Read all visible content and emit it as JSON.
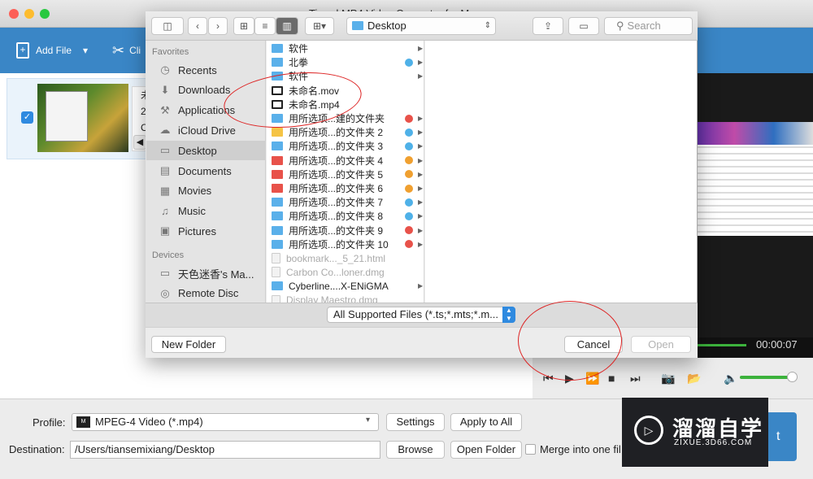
{
  "app": {
    "title": "Tipard MP4 Video Converter for Mac"
  },
  "toolbar": {
    "add_file": "Add File",
    "clip": "Cli"
  },
  "file_item": {
    "line1": "未",
    "line2": "2",
    "line3": "C"
  },
  "preview": {
    "time": "00:00:07"
  },
  "bottom": {
    "profile_label": "Profile:",
    "profile_value": "MPEG-4 Video (*.mp4)",
    "settings": "Settings",
    "apply_all": "Apply to All",
    "destination_label": "Destination:",
    "destination_value": "/Users/tiansemixiang/Desktop",
    "browse": "Browse",
    "open_folder": "Open Folder",
    "merge": "Merge into one fil",
    "convert": "t"
  },
  "watermark": {
    "cn": "溜溜自学",
    "en": "ZIXUE.3D66.COM"
  },
  "dialog": {
    "location": "Desktop",
    "search_placeholder": "Search",
    "favorites_label": "Favorites",
    "devices_label": "Devices",
    "favorites": [
      {
        "label": "Recents",
        "icon": "recents-icon"
      },
      {
        "label": "Downloads",
        "icon": "downloads-icon"
      },
      {
        "label": "Applications",
        "icon": "applications-icon"
      },
      {
        "label": "iCloud Drive",
        "icon": "cloud-icon"
      },
      {
        "label": "Desktop",
        "icon": "desktop-icon"
      },
      {
        "label": "Documents",
        "icon": "documents-icon"
      },
      {
        "label": "Movies",
        "icon": "movies-icon"
      },
      {
        "label": "Music",
        "icon": "music-icon"
      },
      {
        "label": "Pictures",
        "icon": "pictures-icon"
      }
    ],
    "devices": [
      {
        "label": "天色迷香's Ma...",
        "icon": "laptop-icon"
      },
      {
        "label": "Remote Disc",
        "icon": "disc-icon"
      }
    ],
    "files": [
      {
        "name": "软件",
        "kind": "folder",
        "tag": ""
      },
      {
        "name": "北拳",
        "kind": "folder",
        "tag": "#4fb1e8"
      },
      {
        "name": "软件",
        "kind": "folder",
        "tag": ""
      },
      {
        "name": "未命名.mov",
        "kind": "video",
        "tag": ""
      },
      {
        "name": "未命名.mp4",
        "kind": "video",
        "tag": ""
      },
      {
        "name": "用所选项...建的文件夹",
        "kind": "folder",
        "tag": "#e8524a"
      },
      {
        "name": "用所选项...的文件夹 2",
        "kind": "folder-yellow",
        "tag": "#4fb1e8"
      },
      {
        "name": "用所选项...的文件夹 3",
        "kind": "folder",
        "tag": "#4fb1e8"
      },
      {
        "name": "用所选项...的文件夹 4",
        "kind": "folder-red",
        "tag": "#f0a030"
      },
      {
        "name": "用所选项...的文件夹 5",
        "kind": "folder-red",
        "tag": "#f0a030"
      },
      {
        "name": "用所选项...的文件夹 6",
        "kind": "folder-red",
        "tag": "#f0a030"
      },
      {
        "name": "用所选项...的文件夹 7",
        "kind": "folder",
        "tag": "#4fb1e8"
      },
      {
        "name": "用所选项...的文件夹 8",
        "kind": "folder",
        "tag": "#4fb1e8"
      },
      {
        "name": "用所选项...的文件夹 9",
        "kind": "folder",
        "tag": "#e8524a"
      },
      {
        "name": "用所选项...的文件夹 10",
        "kind": "folder",
        "tag": "#e8524a"
      },
      {
        "name": "bookmark..._5_21.html",
        "kind": "doc-dim",
        "tag": ""
      },
      {
        "name": "Carbon Co...loner.dmg",
        "kind": "doc-dim",
        "tag": ""
      },
      {
        "name": "Cyberline....X-ENiGMA",
        "kind": "folder",
        "tag": ""
      },
      {
        "name": "Display Maestro.dmg",
        "kind": "doc-dim",
        "tag": ""
      }
    ],
    "filter": "All Supported Files (*.ts;*.mts;*.m...",
    "new_folder": "New Folder",
    "cancel": "Cancel",
    "open": "Open"
  }
}
